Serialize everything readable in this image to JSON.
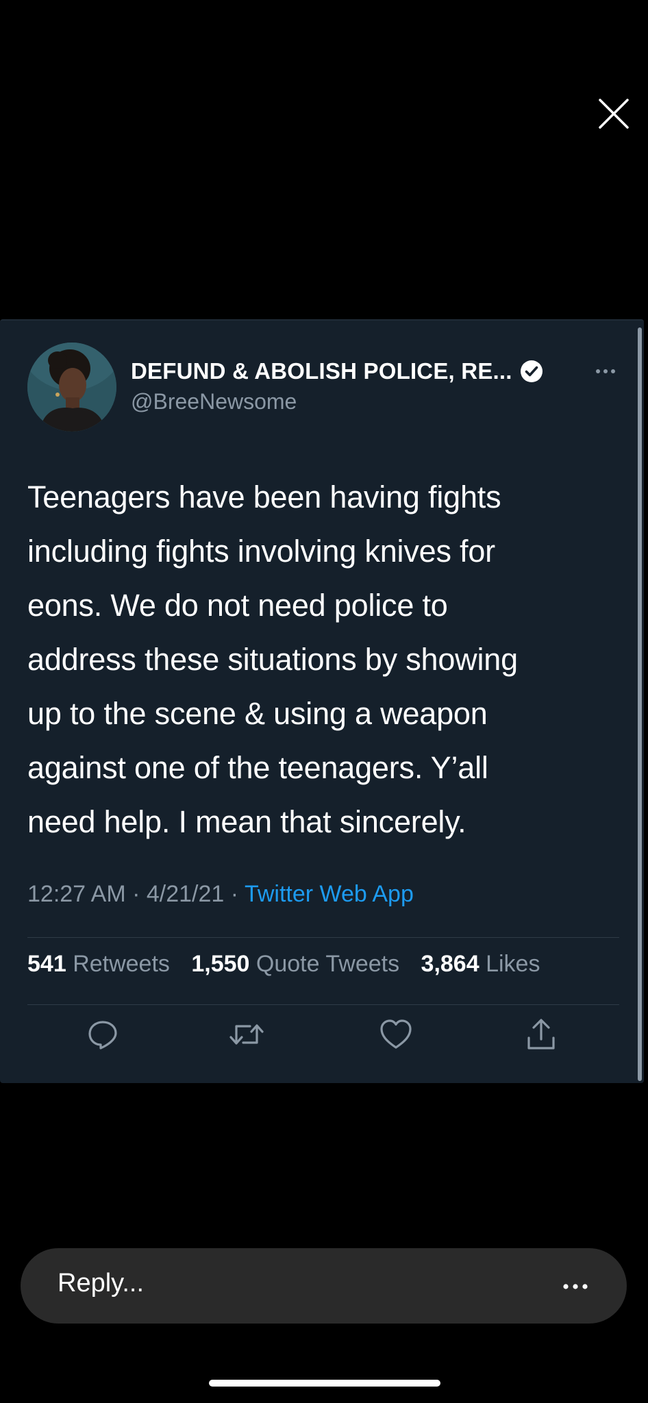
{
  "tweet": {
    "display_name": "DEFUND & ABOLISH POLICE, RE...",
    "handle": "@BreeNewsome",
    "text": "Teenagers have been having fights\nincluding fights involving knives for\neons. We do not need police to\naddress these situations  by showing\nup to the scene & using a weapon\nagainst one of the teenagers. Y’all\nneed help. I mean that sincerely.",
    "time": "12:27 AM",
    "date": "4/21/21",
    "source": "Twitter Web App",
    "separator": " · "
  },
  "stats": {
    "retweets_count": "541",
    "retweets_label": "Retweets",
    "quotes_count": "1,550",
    "quotes_label": "Quote Tweets",
    "likes_count": "3,864",
    "likes_label": "Likes"
  },
  "reply_bar": {
    "placeholder": "Reply..."
  },
  "colors": {
    "background": "#000000",
    "card": "#15202b",
    "accent": "#1d9bf0",
    "muted_text": "#8b98a5"
  },
  "icons": {
    "close": "close-icon",
    "verified": "verified-badge-icon",
    "more": "more-horizontal-icon",
    "reply": "reply-icon",
    "retweet": "retweet-icon",
    "like": "heart-icon",
    "share": "share-icon"
  }
}
